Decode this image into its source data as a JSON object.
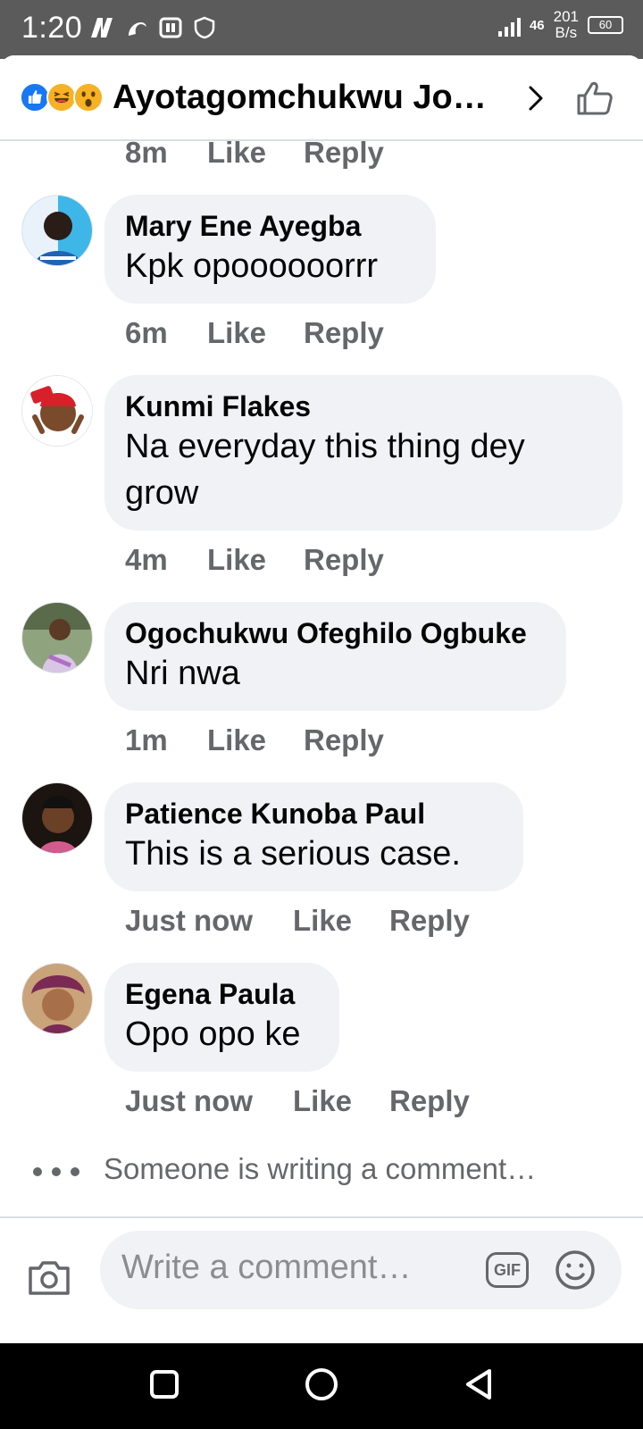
{
  "status_bar": {
    "time": "1:20",
    "network_type": "46",
    "speed_value": "201",
    "speed_unit": "B/s",
    "battery": "60"
  },
  "header": {
    "title": "Ayotagomchukwu Jo…",
    "reaction_icons": [
      "like-reaction",
      "haha-reaction",
      "wow-reaction"
    ]
  },
  "top_meta": {
    "time": "8m",
    "like": "Like",
    "reply": "Reply"
  },
  "comments": [
    {
      "author": "Mary Ene Ayegba",
      "text": "Kpk opoooooorrr",
      "time": "6m",
      "like": "Like",
      "reply": "Reply"
    },
    {
      "author": "Kunmi Flakes",
      "text": "Na everyday this thing dey grow",
      "time": "4m",
      "like": "Like",
      "reply": "Reply"
    },
    {
      "author": "Ogochukwu Ofeghilo Ogbuke",
      "text": "Nri nwa",
      "time": "1m",
      "like": "Like",
      "reply": "Reply"
    },
    {
      "author": "Patience Kunoba Paul",
      "text": "This is a serious case.",
      "time": "Just now",
      "like": "Like",
      "reply": "Reply"
    },
    {
      "author": "Egena Paula",
      "text": "Opo opo ke",
      "time": "Just now",
      "like": "Like",
      "reply": "Reply"
    }
  ],
  "typing_indicator": "Someone is writing a comment…",
  "composer": {
    "placeholder": "Write a comment…",
    "gif_label": "GIF"
  },
  "colors": {
    "bubble_bg": "#f0f2f5",
    "meta_gray": "#65676b",
    "status_bar": "#5b5b5b",
    "accent_blue": "#1877f2"
  }
}
